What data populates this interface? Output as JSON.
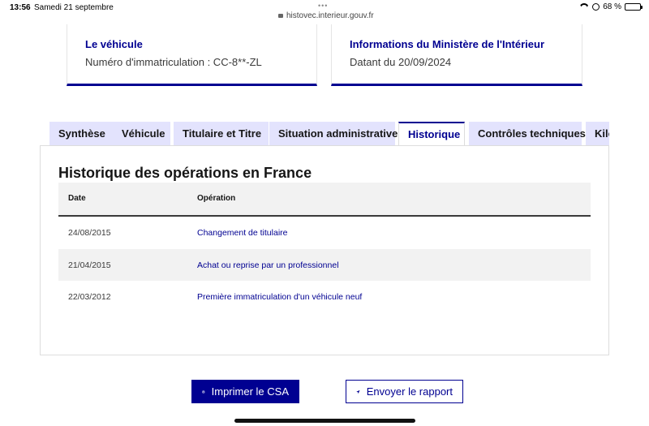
{
  "status_bar": {
    "time": "13:56",
    "date": "Samedi 21 septembre",
    "url": "histovec.interieur.gouv.fr",
    "battery": "68 %",
    "battery_level": 0.68
  },
  "cards": {
    "vehicule": {
      "title": "Le véhicule",
      "text": "Numéro d'immatriculation : CC-8**-ZL"
    },
    "ministere": {
      "title": "Informations du Ministère de l'Intérieur",
      "text": "Datant du 20/09/2024"
    }
  },
  "tabs": [
    {
      "label": "Synthèse",
      "active": false
    },
    {
      "label": "Véhicule",
      "active": false
    },
    {
      "label": "Titulaire et Titre",
      "active": false
    },
    {
      "label": "Situation administrative",
      "active": false
    },
    {
      "label": "Historique",
      "active": true
    },
    {
      "label": "Contrôles techniques",
      "active": false
    },
    {
      "label": "Kilo",
      "active": false
    }
  ],
  "historique": {
    "title": "Historique des opérations en France",
    "columns": {
      "date": "Date",
      "operation": "Opération"
    },
    "rows": [
      {
        "date": "24/08/2015",
        "operation": "Changement de titulaire"
      },
      {
        "date": "21/04/2015",
        "operation": "Achat ou reprise par un professionnel"
      },
      {
        "date": "22/03/2012",
        "operation": "Première immatriculation d'un véhicule neuf"
      }
    ]
  },
  "actions": {
    "print_label": "Imprimer le CSA",
    "send_label": "Envoyer le rapport"
  },
  "colors": {
    "primary": "#000091",
    "tab_bg": "#e3e3fd",
    "row_alt": "#f2f2f2"
  }
}
